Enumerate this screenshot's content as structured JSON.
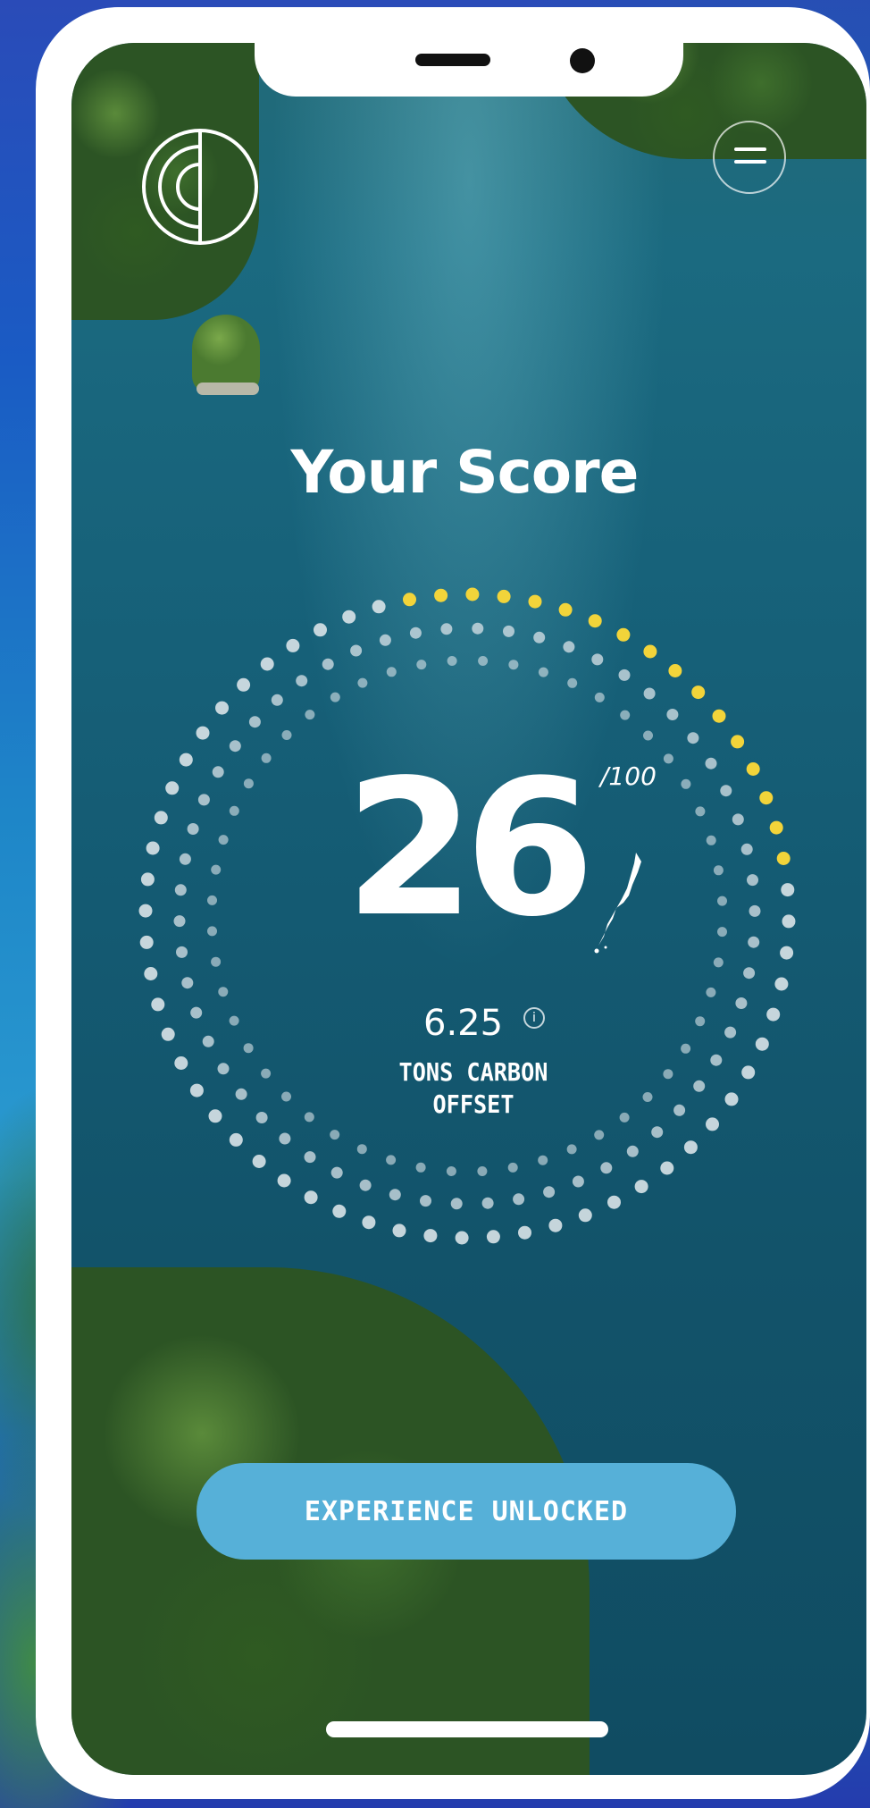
{
  "screen": {
    "title": "Your Score",
    "logo_icon": "concentric-half-circle-logo-icon",
    "menu_icon": "hamburger-menu-icon"
  },
  "score": {
    "value": "26",
    "max_label": "/100",
    "fraction": 0.26,
    "progress_color": "#f2d43a",
    "dot_color": "#d9e3e8"
  },
  "offset": {
    "value": "6.25",
    "info_icon_glyph": "i",
    "label_line1": "TONS CARBON",
    "label_line2": "OFFSET"
  },
  "cta": {
    "label": "EXPERIENCE UNLOCKED",
    "color": "#56b0d8"
  }
}
